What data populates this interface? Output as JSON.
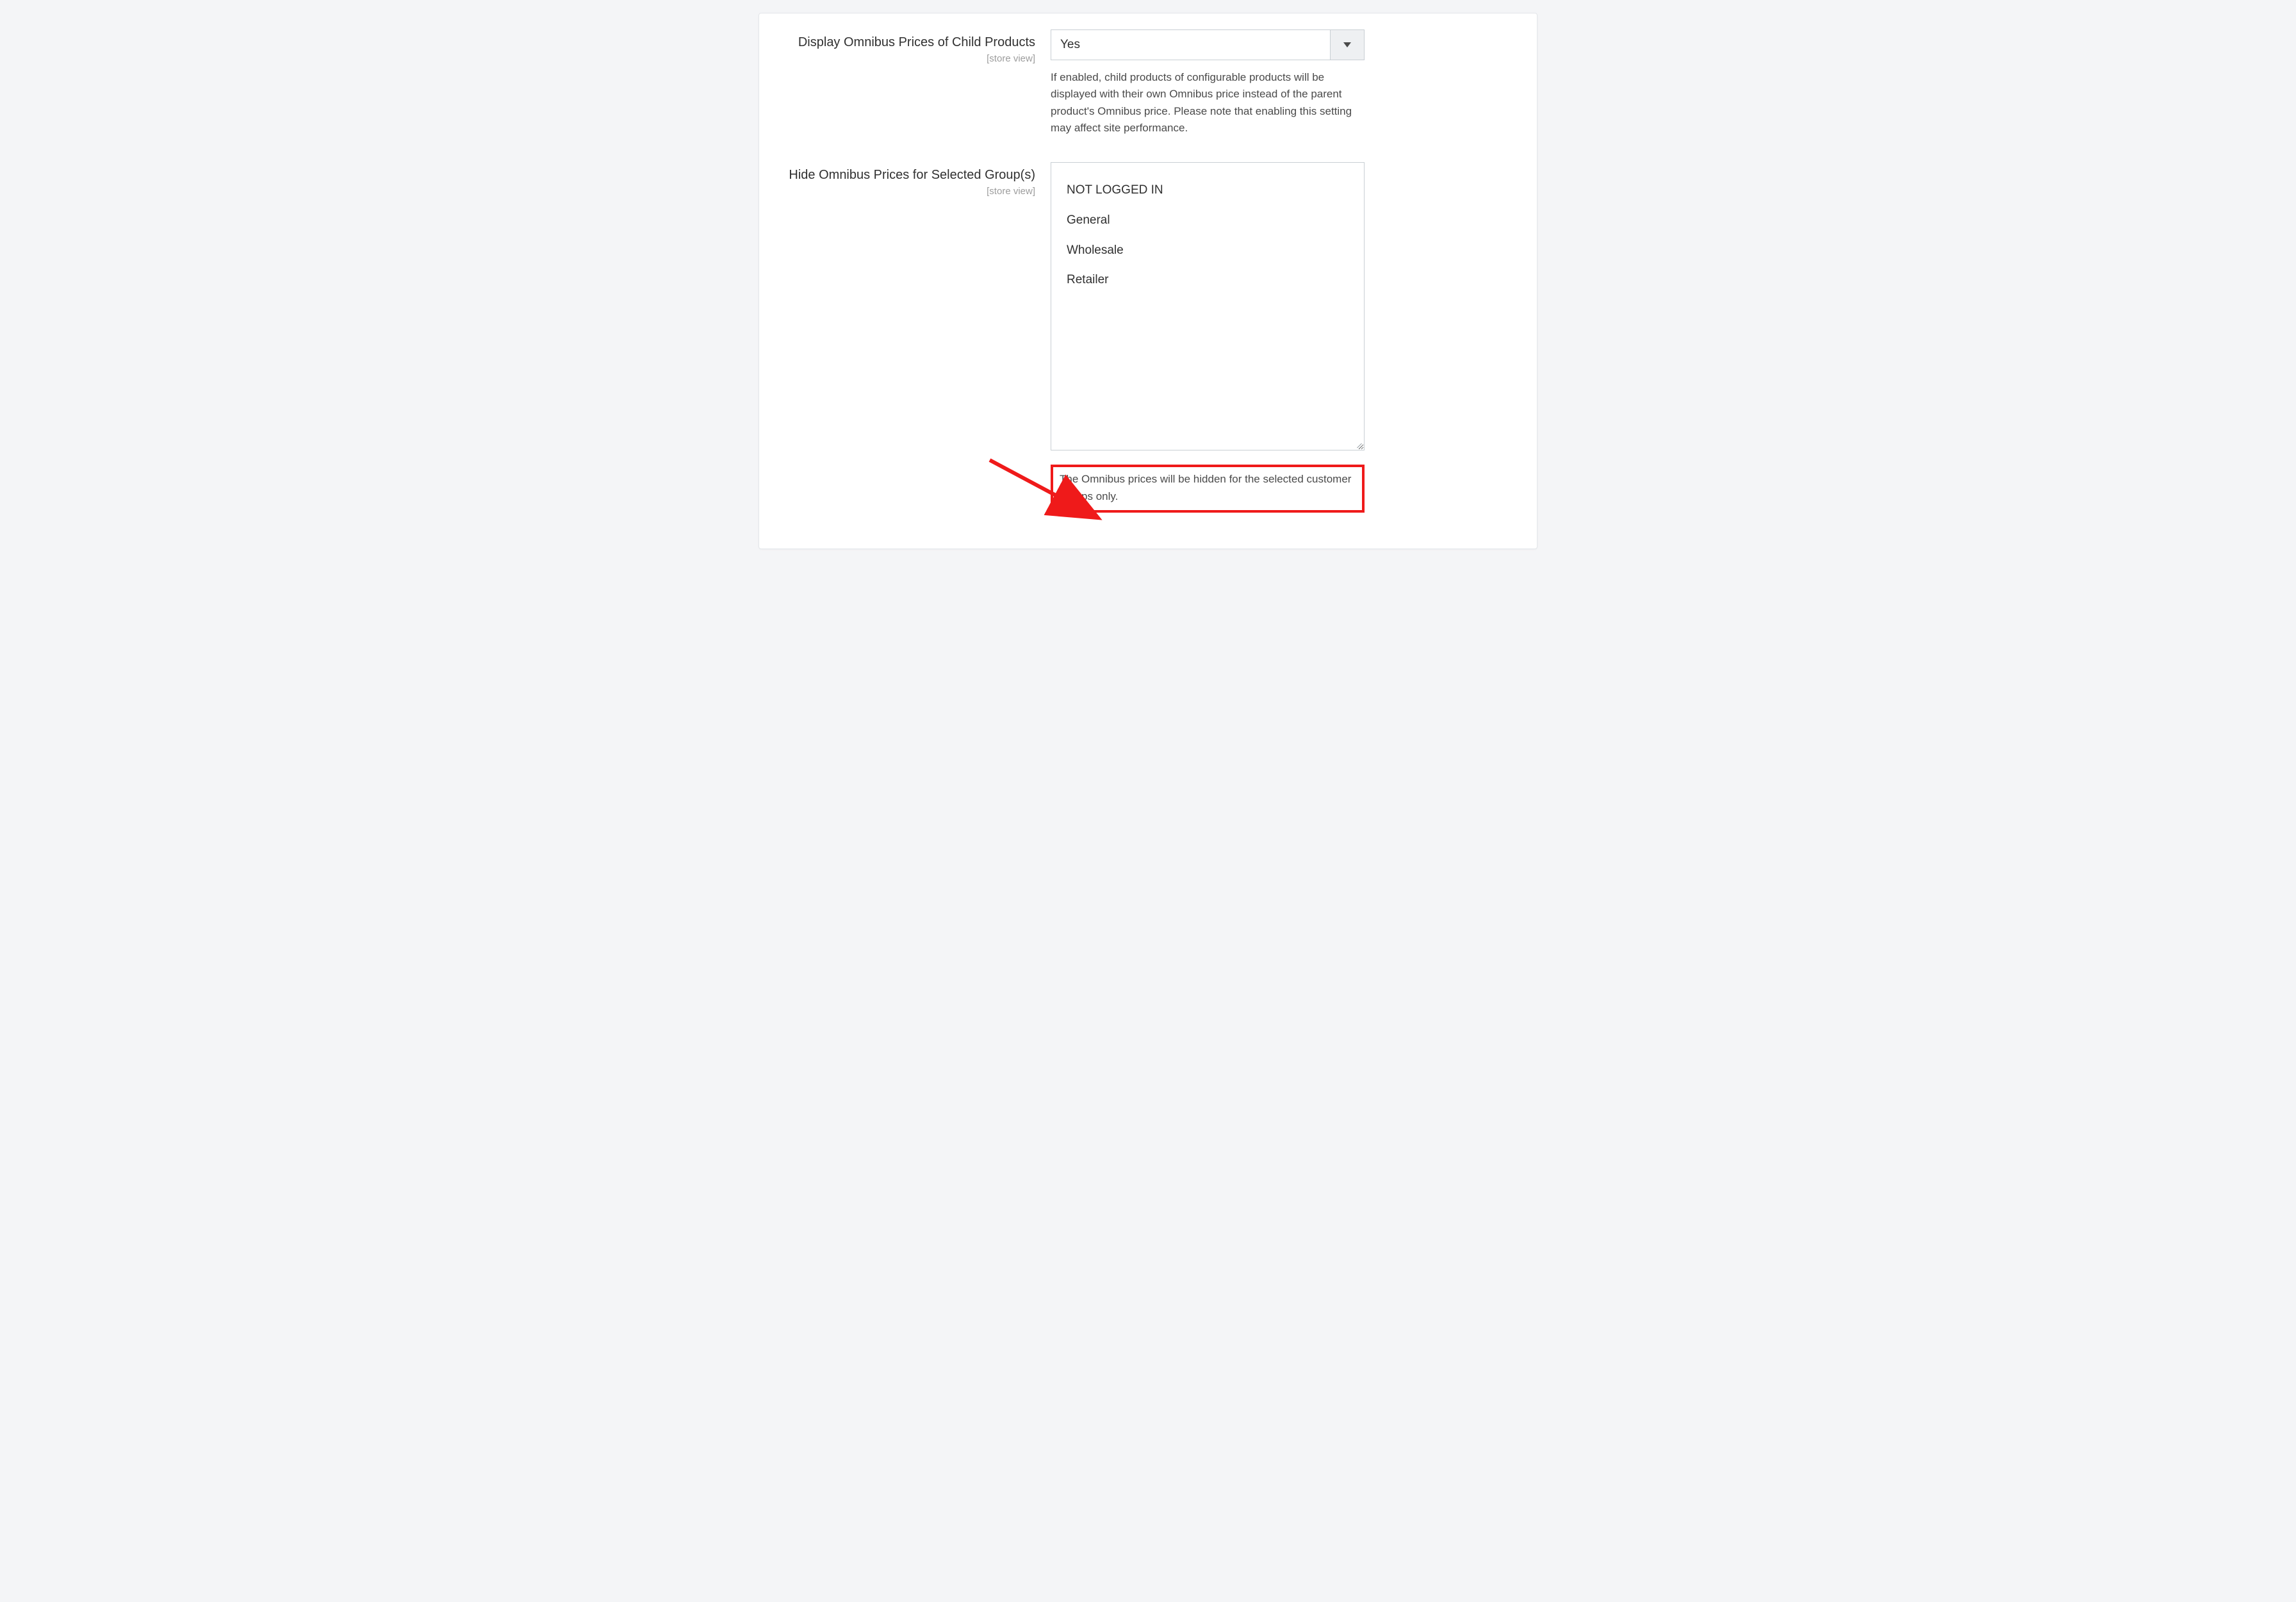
{
  "fields": {
    "child_prices": {
      "label": "Display Omnibus Prices of Child Products",
      "scope": "[store view]",
      "selected": "Yes",
      "note": "If enabled, child products of configurable products will be displayed with their own Omnibus price instead of the parent product's Omnibus price. Please note that enabling this setting may affect site performance."
    },
    "hide_groups": {
      "label": "Hide Omnibus Prices for Selected Group(s)",
      "scope": "[store view]",
      "options": [
        "NOT LOGGED IN",
        "General",
        "Wholesale",
        "Retailer"
      ],
      "note": "The Omnibus prices will be hidden for the selected customer groups only."
    }
  }
}
